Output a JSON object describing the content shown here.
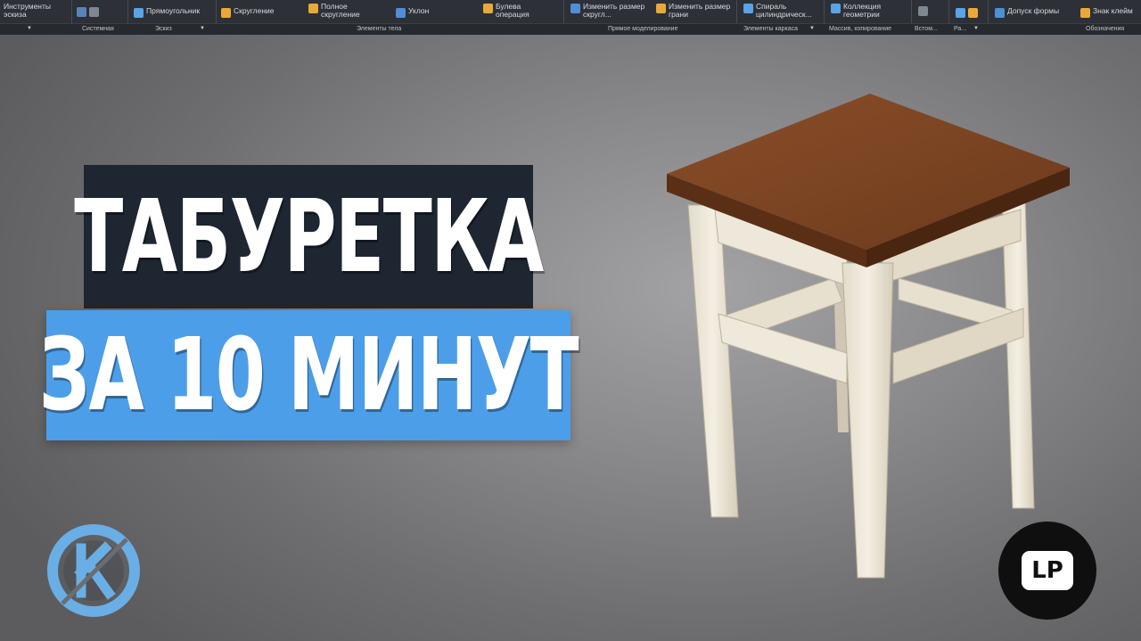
{
  "ribbon": {
    "items": [
      "Инструменты эскиза",
      "Прямоугольник",
      "Скругление",
      "Полное скругление",
      "Уклон",
      "Булева операция",
      "Изменить размер скругл...",
      "Изменить размер грани",
      "Спираль цилиндрическ...",
      "Коллекция геометрии",
      "Допуск формы",
      "Знак клейм"
    ],
    "sections": [
      "Системная",
      "Эскиз",
      "Элементы тела",
      "Прямое моделирование",
      "Элементы каркаса",
      "Массив, копирование",
      "Встом...",
      "Ра...",
      "Обозначения"
    ]
  },
  "title": {
    "line1": "ТАБУРЕТКА",
    "line2": "ЗА 10 МИНУТ"
  },
  "logos": {
    "right_text": "LP"
  },
  "colors": {
    "dark_plate": "#1d2631",
    "blue_plate": "#4c9ee9",
    "seat": "#7a4423",
    "legs": "#f1ece0",
    "logo_k_blue": "#6aaee6"
  }
}
